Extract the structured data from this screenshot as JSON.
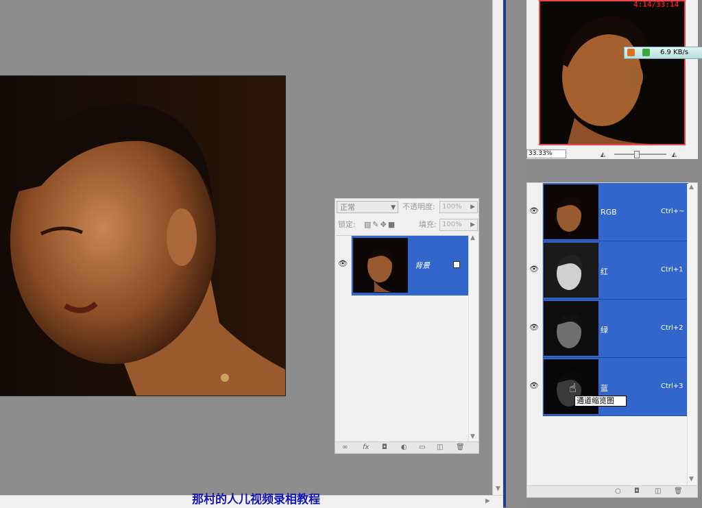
{
  "caption": "那村的人儿视频录相教程",
  "layers_panel": {
    "blend_mode": "正常",
    "opacity_label": "不透明度:",
    "opacity_value": "100%",
    "lock_label": "锁定:",
    "fill_label": "填充:",
    "fill_value": "100%",
    "layers": [
      {
        "name": "背景"
      }
    ],
    "footer_icons": [
      "link-icon",
      "fx-icon",
      "mask-icon",
      "adjustment-icon",
      "folder-icon",
      "new-layer-icon",
      "trash-icon"
    ]
  },
  "navigator": {
    "timer": "4:14/33:14",
    "net_speed": "6.9 KB/s",
    "zoom": "33.33%"
  },
  "channels_panel": {
    "channels": [
      {
        "name": "RGB",
        "shortcut": "Ctrl+~"
      },
      {
        "name": "红",
        "shortcut": "Ctrl+1"
      },
      {
        "name": "绿",
        "shortcut": "Ctrl+2"
      },
      {
        "name": "蓝",
        "shortcut": "Ctrl+3"
      }
    ],
    "tooltip": "通道缩览图",
    "footer_icons": [
      "load-selection-icon",
      "save-selection-icon",
      "new-channel-icon",
      "trash-icon"
    ]
  },
  "colors": {
    "selection": "#3366cc",
    "caption": "#1414b4",
    "timer": "#e02020"
  }
}
